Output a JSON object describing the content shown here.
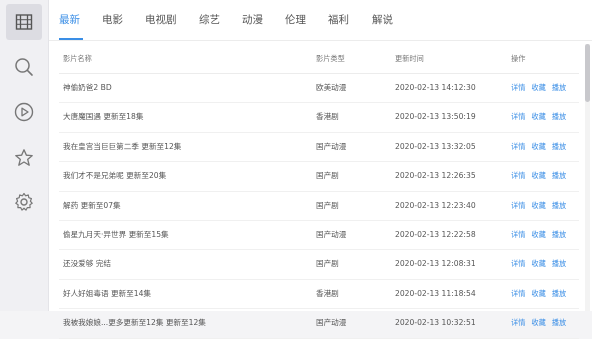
{
  "sidebar": {
    "items": [
      {
        "icon": "film-icon",
        "active": true
      },
      {
        "icon": "search-icon",
        "active": false
      },
      {
        "icon": "play-icon",
        "active": false
      },
      {
        "icon": "star-icon",
        "active": false
      },
      {
        "icon": "gear-icon",
        "active": false
      }
    ]
  },
  "tabs": [
    "最新",
    "电影",
    "电视剧",
    "综艺",
    "动漫",
    "伦理",
    "福利",
    "解说"
  ],
  "table": {
    "headers": {
      "name": "影片名称",
      "type": "影片类型",
      "time": "更新时间",
      "actions": "操作"
    },
    "action_labels": {
      "detail": "详情",
      "fav": "收藏",
      "play": "播放"
    },
    "rows": [
      {
        "name": "神偷奶爸2 BD",
        "type": "欧美动漫",
        "time": "2020-02-13 14:12:30"
      },
      {
        "name": "大唐魔国遇 更新至18集",
        "type": "香港剧",
        "time": "2020-02-13 13:50:19"
      },
      {
        "name": "我在皇宫当巨巨第二季 更新至12集",
        "type": "国产动漫",
        "time": "2020-02-13 13:32:05"
      },
      {
        "name": "我们才不是兄弟呢 更新至20集",
        "type": "国产剧",
        "time": "2020-02-13 12:26:35"
      },
      {
        "name": "解药 更新至07集",
        "type": "国产剧",
        "time": "2020-02-13 12:23:40"
      },
      {
        "name": "偷星九月天·异世界 更新至15集",
        "type": "国产动漫",
        "time": "2020-02-13 12:22:58"
      },
      {
        "name": "还没爱够 完结",
        "type": "国产剧",
        "time": "2020-02-13 12:08:31"
      },
      {
        "name": "好人好姐毒语 更新至14集",
        "type": "香港剧",
        "time": "2020-02-13 11:18:54"
      },
      {
        "name": "我被我娘娘...更多更新至12集 更新至12集",
        "type": "国产动漫",
        "time": "2020-02-13 10:32:51"
      }
    ]
  },
  "colors": {
    "accent": "#3a8ee6",
    "sidebar_bg": "#f0f0f3",
    "text": "#555555"
  }
}
